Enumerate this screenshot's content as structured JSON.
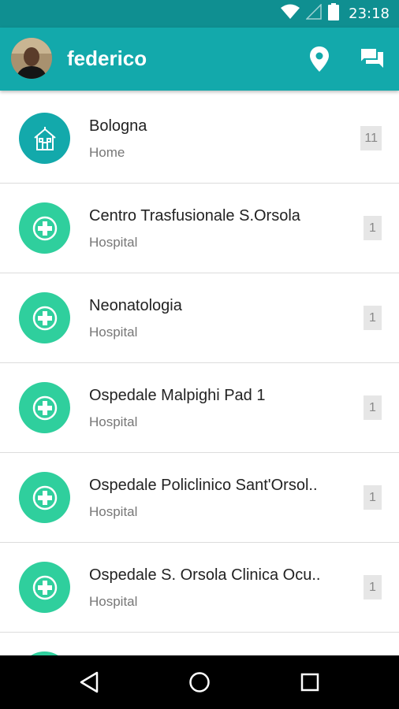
{
  "status_bar": {
    "time": "23:18",
    "icons": [
      "wifi-icon",
      "signal-icon",
      "battery-icon"
    ]
  },
  "app_bar": {
    "user_name": "federico",
    "actions": [
      "location-pin-icon",
      "chat-icon"
    ]
  },
  "places": [
    {
      "title": "Bologna",
      "subtitle": "Home",
      "count": "11",
      "icon": "home-icon"
    },
    {
      "title": "Centro Trasfusionale S.Orsola",
      "subtitle": "Hospital",
      "count": "1",
      "icon": "hospital-cross-icon"
    },
    {
      "title": "Neonatologia",
      "subtitle": "Hospital",
      "count": "1",
      "icon": "hospital-cross-icon"
    },
    {
      "title": "Ospedale Malpighi Pad 1",
      "subtitle": "Hospital",
      "count": "1",
      "icon": "hospital-cross-icon"
    },
    {
      "title": "Ospedale Policlinico Sant'Orsol..",
      "subtitle": "Hospital",
      "count": "1",
      "icon": "hospital-cross-icon"
    },
    {
      "title": "Ospedale S. Orsola Clinica Ocu..",
      "subtitle": "Hospital",
      "count": "1",
      "icon": "hospital-cross-icon"
    },
    {
      "title": "",
      "subtitle": "",
      "count": "",
      "icon": "hospital-cross-icon"
    }
  ],
  "nav": [
    "back-icon",
    "home-circle-icon",
    "recents-icon"
  ],
  "colors": {
    "status_bar": "#0f8f91",
    "app_bar": "#13a9ab",
    "home_icon_bg": "#13a9ab",
    "hospital_icon_bg": "#2fcf9d"
  }
}
